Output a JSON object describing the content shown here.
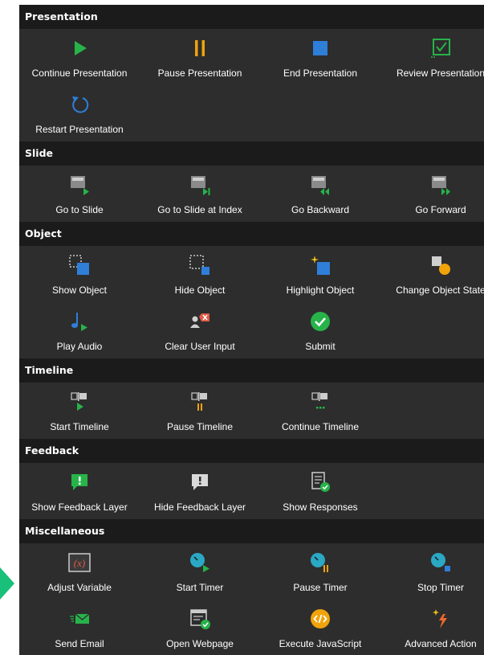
{
  "colors": {
    "green": "#27b34a",
    "orange": "#f0a30a",
    "blue": "#2f7ed8",
    "teal": "#2aa8c4",
    "red": "#e25a45",
    "background": "#2d2d2d",
    "header": "#1b1b1b"
  },
  "sections": [
    {
      "title": "Presentation",
      "items": [
        {
          "label": "Continue Presentation",
          "icon": "play-icon"
        },
        {
          "label": "Pause Presentation",
          "icon": "pause-icon"
        },
        {
          "label": "End Presentation",
          "icon": "stop-icon"
        },
        {
          "label": "Review Presentation",
          "icon": "review-icon"
        },
        {
          "label": "Restart Presentation",
          "icon": "restart-icon"
        }
      ]
    },
    {
      "title": "Slide",
      "items": [
        {
          "label": "Go to Slide",
          "icon": "slide-play-icon"
        },
        {
          "label": "Go to Slide at Index",
          "icon": "slide-index-icon"
        },
        {
          "label": "Go Backward",
          "icon": "slide-backward-icon"
        },
        {
          "label": "Go Forward",
          "icon": "slide-forward-icon"
        }
      ]
    },
    {
      "title": "Object",
      "items": [
        {
          "label": "Show Object",
          "icon": "show-object-icon"
        },
        {
          "label": "Hide Object",
          "icon": "hide-object-icon"
        },
        {
          "label": "Highlight Object",
          "icon": "highlight-object-icon"
        },
        {
          "label": "Change Object State",
          "icon": "object-state-icon"
        },
        {
          "label": "Play Audio",
          "icon": "audio-icon"
        },
        {
          "label": "Clear User Input",
          "icon": "clear-input-icon"
        },
        {
          "label": "Submit",
          "icon": "submit-icon"
        }
      ]
    },
    {
      "title": "Timeline",
      "items": [
        {
          "label": "Start Timeline",
          "icon": "timeline-start-icon"
        },
        {
          "label": "Pause Timeline",
          "icon": "timeline-pause-icon"
        },
        {
          "label": "Continue Timeline",
          "icon": "timeline-continue-icon"
        }
      ]
    },
    {
      "title": "Feedback",
      "items": [
        {
          "label": "Show Feedback Layer",
          "icon": "feedback-show-icon"
        },
        {
          "label": "Hide Feedback Layer",
          "icon": "feedback-hide-icon"
        },
        {
          "label": "Show Responses",
          "icon": "responses-icon"
        }
      ]
    },
    {
      "title": "Miscellaneous",
      "items": [
        {
          "label": "Adjust Variable",
          "icon": "variable-icon"
        },
        {
          "label": "Start Timer",
          "icon": "timer-start-icon"
        },
        {
          "label": "Pause Timer",
          "icon": "timer-pause-icon"
        },
        {
          "label": "Stop Timer",
          "icon": "timer-stop-icon"
        },
        {
          "label": "Send Email",
          "icon": "email-icon"
        },
        {
          "label": "Open Webpage",
          "icon": "webpage-icon"
        },
        {
          "label": "Execute JavaScript",
          "icon": "javascript-icon"
        },
        {
          "label": "Advanced Action",
          "icon": "advanced-action-icon"
        }
      ]
    }
  ]
}
